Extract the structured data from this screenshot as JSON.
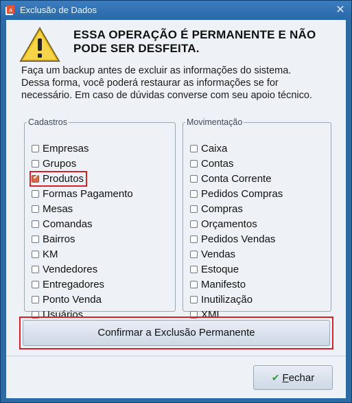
{
  "window": {
    "title": "Exclusão de Dados",
    "close_glyph": "✕"
  },
  "warning": {
    "icon": "warning-triangle-icon",
    "headline_line1": "ESSA OPERAÇÃO É PERMANENTE E NÃO",
    "headline_line2": "PODE SER DESFEITA.",
    "desc_line1": "Faça um backup antes de excluir as informações do sistema.",
    "desc_line2": "Dessa forma, você poderá restaurar as informações se for",
    "desc_line3": "necessário. Em caso de dúvidas converse com seu apoio técnico."
  },
  "cadastros": {
    "legend": "Cadastros",
    "items": [
      {
        "label": "Empresas",
        "checked": false
      },
      {
        "label": "Grupos",
        "checked": false
      },
      {
        "label": "Produtos",
        "checked": true
      },
      {
        "label": "Formas Pagamento",
        "checked": false
      },
      {
        "label": "Mesas",
        "checked": false
      },
      {
        "label": "Comandas",
        "checked": false
      },
      {
        "label": "Bairros",
        "checked": false
      },
      {
        "label": "KM",
        "checked": false
      },
      {
        "label": "Vendedores",
        "checked": false
      },
      {
        "label": "Entregadores",
        "checked": false
      },
      {
        "label": "Ponto Venda",
        "checked": false
      },
      {
        "label": "Usuários",
        "checked": false
      }
    ]
  },
  "movimentacao": {
    "legend": "Movimentação",
    "items": [
      {
        "label": "Caixa",
        "checked": false
      },
      {
        "label": "Contas",
        "checked": false
      },
      {
        "label": "Conta Corrente",
        "checked": false
      },
      {
        "label": "Pedidos Compras",
        "checked": false
      },
      {
        "label": "Compras",
        "checked": false
      },
      {
        "label": "Orçamentos",
        "checked": false
      },
      {
        "label": "Pedidos Vendas",
        "checked": false
      },
      {
        "label": "Vendas",
        "checked": false
      },
      {
        "label": "Estoque",
        "checked": false
      },
      {
        "label": "Manifesto",
        "checked": false
      },
      {
        "label": "Inutilização",
        "checked": false
      },
      {
        "label": "XML",
        "checked": false
      }
    ]
  },
  "actions": {
    "confirm_label": "Confirmar a Exclusão Permanente",
    "close_label_first": "F",
    "close_label_rest": "echar"
  },
  "colors": {
    "title_bar": "#2a67a6",
    "highlight": "#d6212a",
    "checked": "#d2694b"
  }
}
